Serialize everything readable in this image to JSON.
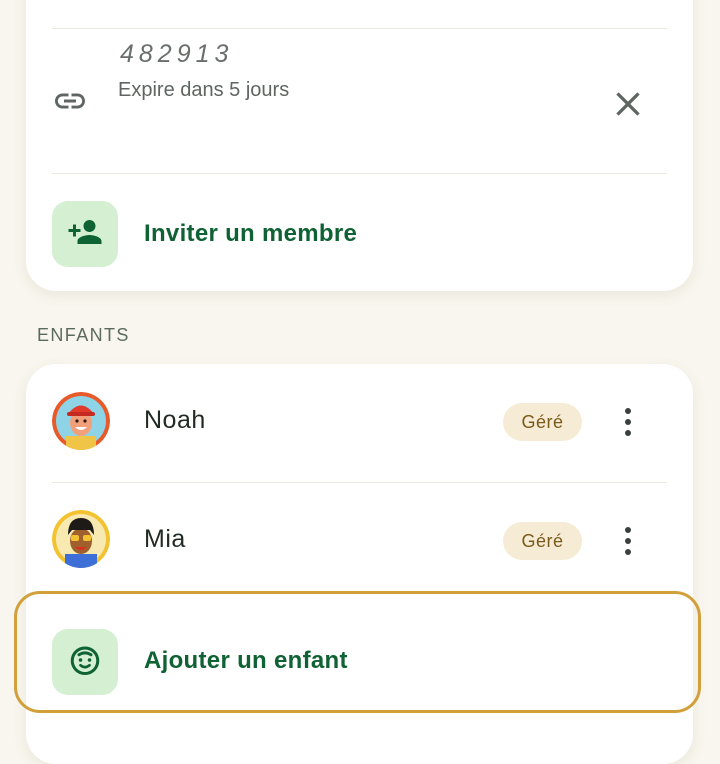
{
  "invite_code": {
    "code": "482913",
    "expiry": "Expire dans 5 jours",
    "link_icon": "link-icon",
    "close_icon": "close-icon"
  },
  "invite_member": {
    "label": "Inviter un membre",
    "icon": "person-add-icon"
  },
  "children_section": {
    "header": "ENFANTS",
    "children": [
      {
        "name": "Noah",
        "badge": "Géré",
        "avatar": "avatar-noah",
        "menu_icon": "more-vert-icon"
      },
      {
        "name": "Mia",
        "badge": "Géré",
        "avatar": "avatar-mia",
        "menu_icon": "more-vert-icon"
      }
    ]
  },
  "add_child": {
    "label": "Ajouter un enfant",
    "icon": "child-face-icon"
  },
  "colors": {
    "accent_green": "#0f6233",
    "icon_bg": "#d4efd2",
    "badge_bg": "#f6ecd5",
    "badge_text": "#7a5a1a",
    "highlight": "#d2a03a",
    "page_bg": "#f8f6ee"
  }
}
